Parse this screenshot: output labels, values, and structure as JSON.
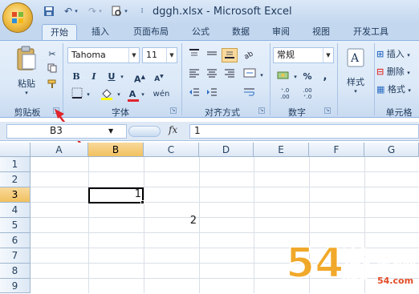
{
  "window": {
    "title": "dggh.xlsx - Microsoft Excel"
  },
  "quick_access": [
    "save-icon",
    "undo-icon",
    "redo-icon",
    "print-preview-icon",
    "customize-icon"
  ],
  "tabs": [
    "开始",
    "插入",
    "页面布局",
    "公式",
    "数据",
    "审阅",
    "视图",
    "开发工具"
  ],
  "active_tab": "开始",
  "ribbon": {
    "clipboard": {
      "label": "剪贴板",
      "paste": "粘贴"
    },
    "font": {
      "label": "字体",
      "font_name": "Tahoma",
      "font_size": "11"
    },
    "alignment": {
      "label": "对齐方式"
    },
    "number": {
      "label": "数字",
      "format": "常规"
    },
    "styles": {
      "label": "样式"
    },
    "cells": {
      "label": "单元格",
      "insert": "插入",
      "delete": "删除",
      "format": "格式"
    }
  },
  "formula_bar": {
    "name_box": "B3",
    "fx": "fx",
    "value": "1"
  },
  "grid": {
    "columns": [
      "A",
      "B",
      "C",
      "D",
      "E",
      "F",
      "G"
    ],
    "rows": [
      "1",
      "2",
      "3",
      "4",
      "5",
      "6",
      "7",
      "8",
      "9"
    ],
    "selected_column": "B",
    "selected_row": "3",
    "cells": {
      "B3": "1",
      "C5": "2"
    }
  },
  "watermark": {
    "brand": "54游手游网",
    "url": "54.com"
  },
  "colors": {
    "ribbon_blue": "#dbe8f7",
    "selected_header": "#f1c15f",
    "annotation_arrow": "#e0242b"
  }
}
